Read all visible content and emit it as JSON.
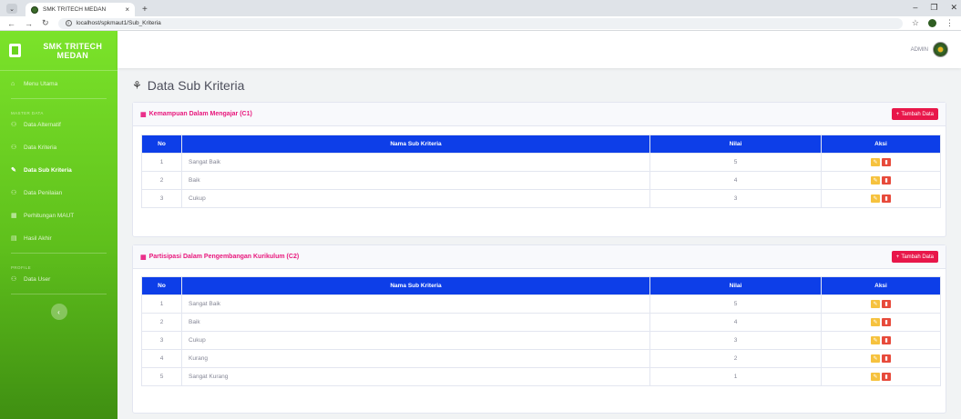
{
  "browser": {
    "tab_title": "SMK TRITECH MEDAN",
    "url": "localhost/spkmaut1/Sub_Kriteria"
  },
  "sidebar": {
    "brand": "SMK TRITECH MEDAN",
    "menu_utama": "Menu Utama",
    "section_master": "MASTER DATA",
    "items": [
      {
        "label": "Data Alternatif",
        "icon": "users-icon"
      },
      {
        "label": "Data Kriteria",
        "icon": "cube-icon"
      },
      {
        "label": "Data Sub Kriteria",
        "icon": "edit-icon"
      },
      {
        "label": "Data Penilaian",
        "icon": "users-icon"
      },
      {
        "label": "Perhitungan MAUT",
        "icon": "calculator-icon"
      },
      {
        "label": "Hasil Akhir",
        "icon": "chart-icon"
      }
    ],
    "section_profile": "PROFILE",
    "profile_item": "Data User"
  },
  "topbar": {
    "user": "ADMIN"
  },
  "page": {
    "title": "Data Sub Kriteria"
  },
  "common": {
    "add_label": "Tambah Data",
    "col_no": "No",
    "col_name": "Nama Sub Kriteria",
    "col_value": "Nilai",
    "col_action": "Aksi"
  },
  "cards": [
    {
      "title": "Kemampuan Dalam Mengajar (C1)",
      "rows": [
        {
          "no": "1",
          "name": "Sangat Baik",
          "value": "5"
        },
        {
          "no": "2",
          "name": "Baik",
          "value": "4"
        },
        {
          "no": "3",
          "name": "Cukup",
          "value": "3"
        }
      ]
    },
    {
      "title": "Partisipasi Dalam Pengembangan Kurikulum (C2)",
      "rows": [
        {
          "no": "1",
          "name": "Sangat Baik",
          "value": "5"
        },
        {
          "no": "2",
          "name": "Baik",
          "value": "4"
        },
        {
          "no": "3",
          "name": "Cukup",
          "value": "3"
        },
        {
          "no": "4",
          "name": "Kurang",
          "value": "2"
        },
        {
          "no": "5",
          "name": "Sangat Kurang",
          "value": "1"
        }
      ]
    }
  ]
}
